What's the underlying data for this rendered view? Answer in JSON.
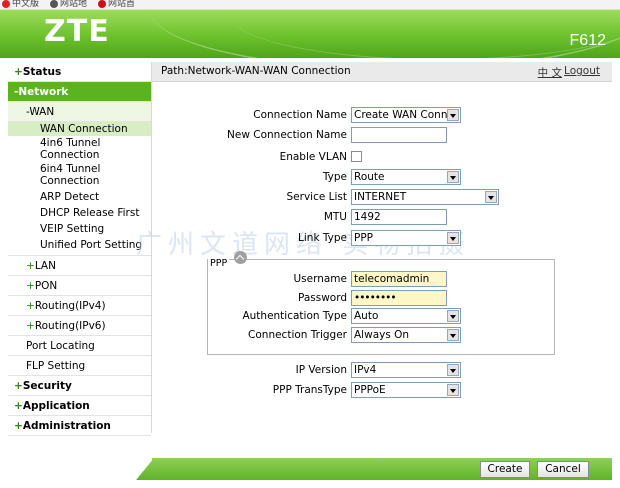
{
  "bookmarks": [
    "中文版",
    "网站地",
    "网站首"
  ],
  "header": {
    "brand": "ZTE",
    "model": "F612"
  },
  "nav": {
    "status": "Status",
    "network": "-Network",
    "wan": "-WAN",
    "wan_items": [
      "WAN Connection",
      "4in6 Tunnel\nConnection",
      "6in4 Tunnel\nConnection",
      "ARP Detect",
      "DHCP Release First",
      "VEIP Setting",
      "Unified Port Setting"
    ],
    "lan": "LAN",
    "pon": "PON",
    "routing_v4": "Routing(IPv4)",
    "routing_v6": "Routing(IPv6)",
    "port_locating": "Port Locating",
    "flp_setting": "FLP Setting",
    "security": "Security",
    "application": "Application",
    "administration": "Administration"
  },
  "topbar": {
    "path": "Path:Network-WAN-WAN Connection",
    "lang": "中 文",
    "logout": "Logout"
  },
  "form": {
    "connection_name_label": "Connection Name",
    "connection_name_value": "Create WAN Conne",
    "new_connection_name_label": "New Connection Name",
    "new_connection_name_value": "",
    "enable_vlan_label": "Enable VLAN",
    "enable_vlan_checked": false,
    "type_label": "Type",
    "type_value": "Route",
    "service_list_label": "Service List",
    "service_list_value": "INTERNET",
    "mtu_label": "MTU",
    "mtu_value": "1492",
    "link_type_label": "Link Type",
    "link_type_value": "PPP",
    "ppp_legend": "PPP",
    "username_label": "Username",
    "username_value": "telecomadmin",
    "password_label": "Password",
    "password_value": "••••••••",
    "auth_type_label": "Authentication Type",
    "auth_type_value": "Auto",
    "conn_trigger_label": "Connection Trigger",
    "conn_trigger_value": "Always On",
    "ip_version_label": "IP Version",
    "ip_version_value": "IPv4",
    "ppp_transtype_label": "PPP TransType",
    "ppp_transtype_value": "PPPoE"
  },
  "watermark": "广州文道网络 实物拍摄",
  "buttons": {
    "create": "Create",
    "cancel": "Cancel"
  },
  "colors": {
    "brand_green": "#5ab31f",
    "highlight_yellow": "#fff8c6"
  }
}
